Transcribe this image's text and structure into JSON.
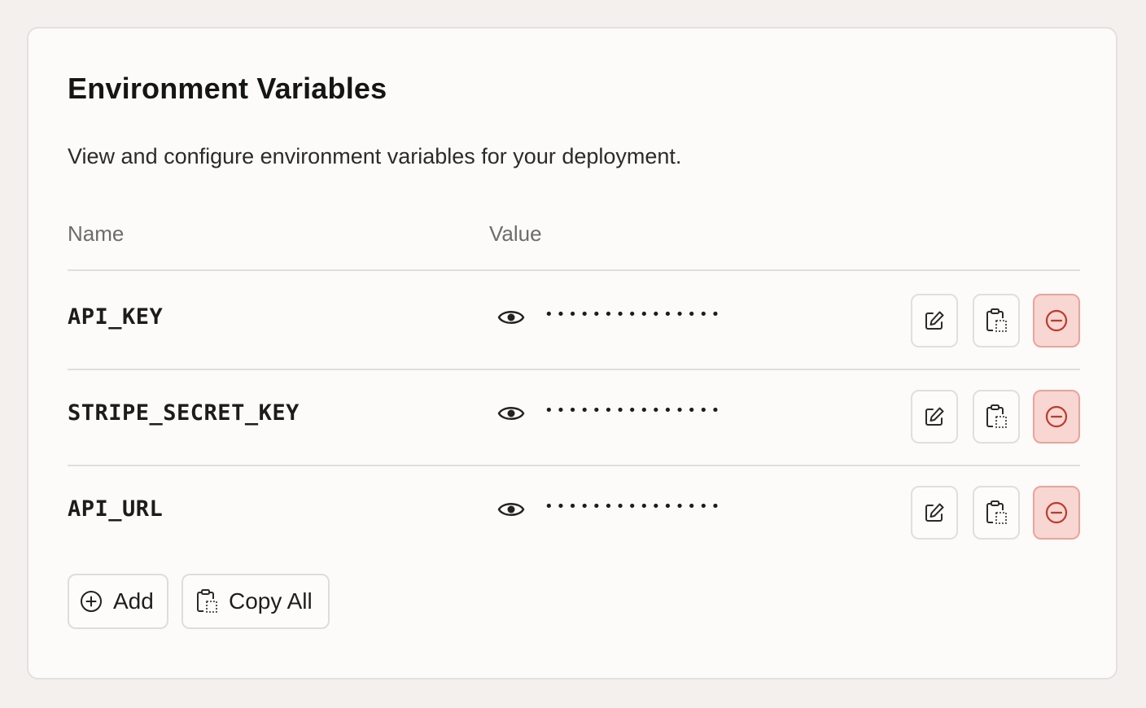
{
  "card": {
    "title": "Environment Variables",
    "subtitle": "View and configure environment variables for your deployment."
  },
  "table": {
    "columns": [
      "Name",
      "Value"
    ],
    "rows": [
      {
        "name": "API_KEY",
        "masked_value": "•••••••••••••••"
      },
      {
        "name": "STRIPE_SECRET_KEY",
        "masked_value": "•••••••••••••••"
      },
      {
        "name": "API_URL",
        "masked_value": "•••••••••••••••"
      }
    ],
    "row_actions": [
      "edit-icon",
      "copy-icon",
      "remove-icon"
    ]
  },
  "actions": {
    "add_label": "Add",
    "copy_all_label": "Copy All"
  },
  "colors": {
    "background": "#f3f0ed",
    "card": "#fcfbf9",
    "danger_fill": "#f8d6d1",
    "danger_border": "#eaa49c",
    "danger_icon": "#c0392b"
  }
}
